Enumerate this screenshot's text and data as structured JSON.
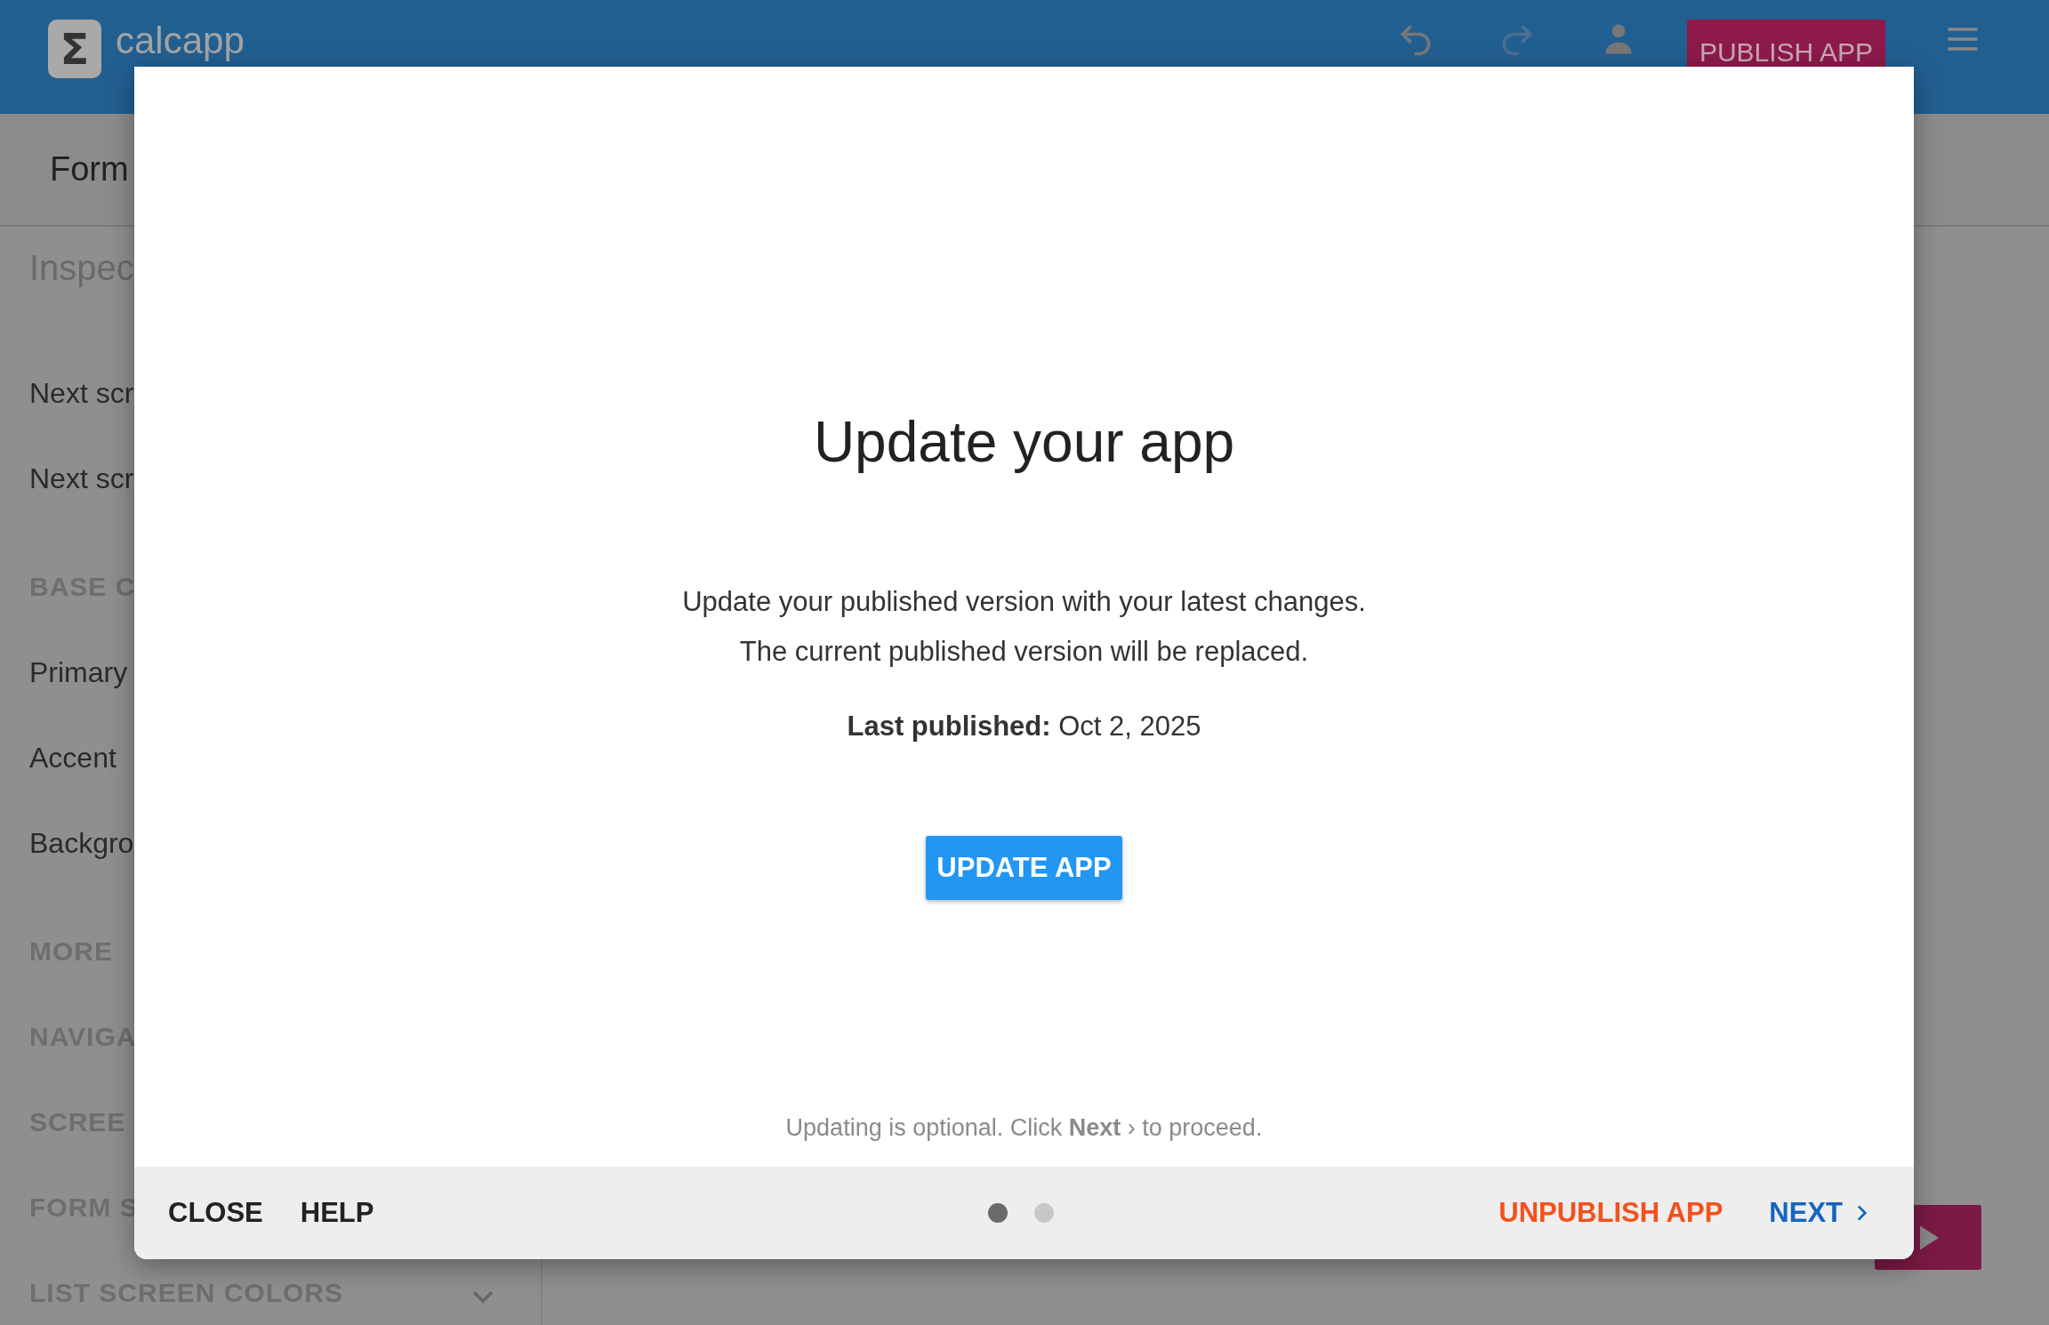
{
  "app_bar": {
    "logo_mark": "Σ",
    "app_name": "calcapp",
    "publish_button": "PUBLISH APP"
  },
  "toolbar": {
    "title": "Form"
  },
  "sidebar": {
    "title": "Inspec",
    "items": [
      {
        "kind": "item",
        "label": "Next scr"
      },
      {
        "kind": "item",
        "label": "Next scr"
      },
      {
        "kind": "heading",
        "label": "BASE C"
      },
      {
        "kind": "item",
        "label": "Primary"
      },
      {
        "kind": "item",
        "label": "Accent"
      },
      {
        "kind": "item",
        "label": "Backgro"
      },
      {
        "kind": "heading",
        "label": "MORE"
      },
      {
        "kind": "heading",
        "label": "NAVIGA"
      },
      {
        "kind": "heading",
        "label": "SCREE"
      },
      {
        "kind": "heading",
        "label": "FORM S"
      },
      {
        "kind": "section",
        "label": "LIST SCREEN COLORS"
      }
    ]
  },
  "dialog": {
    "title": "Update your app",
    "lines": [
      "Update your published version with your latest changes.",
      "The current published version will be replaced."
    ],
    "last_published": "**Last published:** Oct 2, 2025",
    "primary_button": "UPDATE APP",
    "hint": "Updating is optional. Click **Next** ›  to proceed.",
    "left_buttons": [
      "CLOSE",
      "HELP"
    ],
    "pages": [
      {
        "selected": true
      },
      {
        "selected": false
      }
    ],
    "unpublish_button": "UNPUBLISH APP",
    "next_button": "NEXT"
  }
}
